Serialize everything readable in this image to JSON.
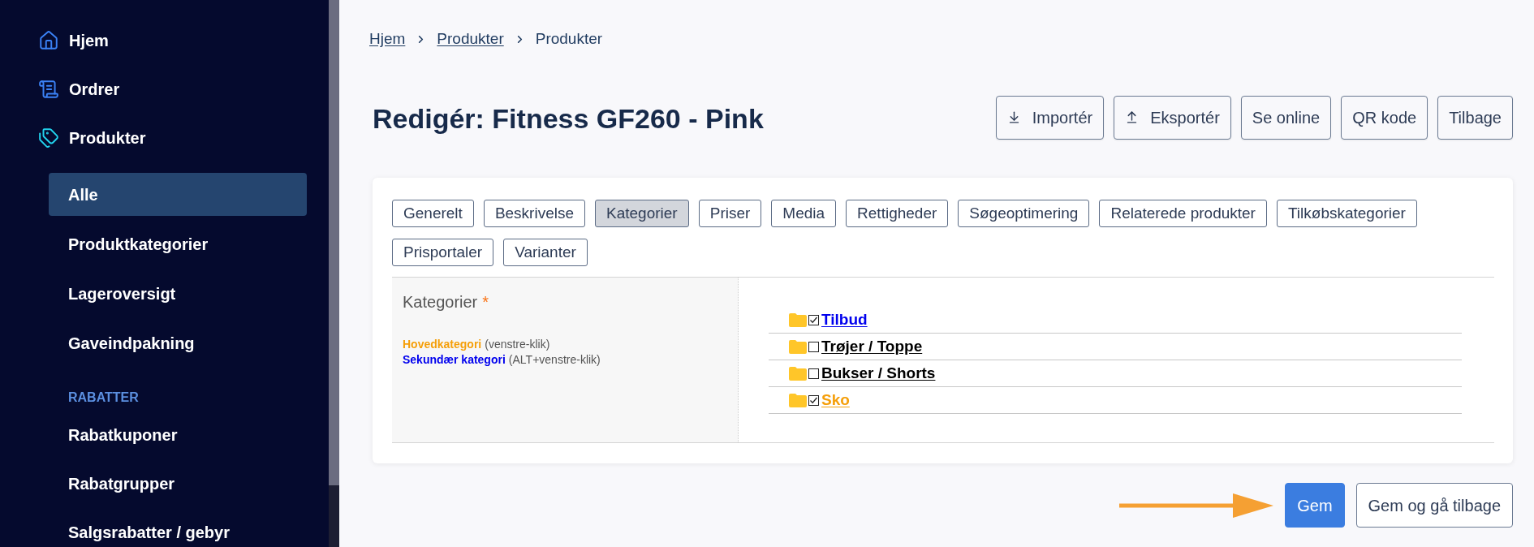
{
  "sidebar": {
    "nav": [
      {
        "label": "Hjem"
      },
      {
        "label": "Ordrer"
      },
      {
        "label": "Produkter"
      }
    ],
    "sub_items": [
      {
        "label": "Alle",
        "selected": true
      },
      {
        "label": "Produktkategorier",
        "selected": false
      },
      {
        "label": "Lageroversigt",
        "selected": false
      },
      {
        "label": "Gaveindpakning",
        "selected": false
      }
    ],
    "section": {
      "heading": "RABATTER",
      "items": [
        {
          "label": "Rabatkuponer",
          "selected": false
        },
        {
          "label": "Rabatgrupper",
          "selected": false
        },
        {
          "label": "Salgsrabatter / gebyr",
          "selected": false
        }
      ]
    }
  },
  "breadcrumb": [
    {
      "label": "Hjem",
      "link": true
    },
    {
      "label": "Produkter",
      "link": true
    },
    {
      "label": "Produkter",
      "link": false
    }
  ],
  "title": "Redigér: Fitness GF260 - Pink",
  "header_buttons": [
    {
      "label": "Importér",
      "kind": "import"
    },
    {
      "label": "Eksportér",
      "kind": "export"
    },
    {
      "label": "Se online",
      "kind": "plain"
    },
    {
      "label": "QR kode",
      "kind": "plain"
    },
    {
      "label": "Tilbage",
      "kind": "plain"
    }
  ],
  "tabs": [
    {
      "label": "Generelt",
      "selected": false
    },
    {
      "label": "Beskrivelse",
      "selected": false
    },
    {
      "label": "Kategorier",
      "selected": true
    },
    {
      "label": "Priser",
      "selected": false
    },
    {
      "label": "Media",
      "selected": false
    },
    {
      "label": "Rettigheder",
      "selected": false
    },
    {
      "label": "Søgeoptimering",
      "selected": false
    },
    {
      "label": "Relaterede produkter",
      "selected": false
    },
    {
      "label": "Tilkøbskategorier",
      "selected": false
    },
    {
      "label": "Prisportaler",
      "selected": false
    },
    {
      "label": "Varianter",
      "selected": false
    }
  ],
  "categories": {
    "label": "Kategorier",
    "required_mark": "*",
    "legend": [
      {
        "term": "Hovedkategori",
        "note": "(venstre-klik)",
        "color": "#f59f0a"
      },
      {
        "term": "Sekundær kategori",
        "note": "(ALT+venstre-klik)",
        "color": "#0000ee"
      }
    ],
    "tree": [
      {
        "label": "Tilbud",
        "checked": true,
        "color": "#0000ee"
      },
      {
        "label": "Trøjer / Toppe",
        "checked": false,
        "color": "#000000"
      },
      {
        "label": "Bukser / Shorts",
        "checked": false,
        "color": "#000000"
      },
      {
        "label": "Sko",
        "checked": true,
        "color": "#f59f0a"
      }
    ]
  },
  "footer_buttons": [
    {
      "label": "Gem",
      "kind": "primary"
    },
    {
      "label": "Gem og gå tilbage",
      "kind": "secondary"
    }
  ]
}
